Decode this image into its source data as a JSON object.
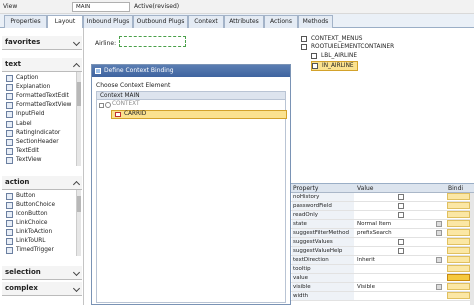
{
  "topbar": {
    "view_label": "View",
    "view_value": "MAIN",
    "status": "Active(revised)"
  },
  "tabs": [
    "Properties",
    "Layout",
    "Inbound Plugs",
    "Outbound Plugs",
    "Context",
    "Attributes",
    "Actions",
    "Methods"
  ],
  "active_tab": "Layout",
  "palette": {
    "sections": [
      {
        "title": "favorites"
      },
      {
        "title": "text",
        "items": [
          "Caption",
          "Explanation",
          "FormattedTextEdit",
          "FormattedTextView",
          "InputField",
          "Label",
          "RatingIndicator",
          "SectionHeader",
          "TextEdit",
          "TextView"
        ]
      },
      {
        "title": "action",
        "items": [
          "Button",
          "ButtonChoice",
          "IconButton",
          "LinkChoice",
          "LinkToAction",
          "LinkToURL",
          "TimedTrigger"
        ]
      },
      {
        "title": "selection"
      },
      {
        "title": "complex"
      }
    ]
  },
  "canvas": {
    "airline_label": "Airline:"
  },
  "dialog": {
    "title": "Define Context Binding",
    "subtitle": "Choose Context Element",
    "header": "Context MAIN",
    "node_root": "CONTEXT",
    "node_child": "CARRID"
  },
  "element_tree": [
    {
      "label": "CONTEXT_MENUS"
    },
    {
      "label": "ROOTUIELEMENTCONTAINER"
    },
    {
      "label": "LBL_AIRLINE"
    },
    {
      "label": "IN_AIRLINE"
    }
  ],
  "properties": {
    "headers": [
      "Property",
      "Value",
      "Bindi"
    ],
    "rows": [
      {
        "name": "noHistory",
        "value": "",
        "kind": "checkbox"
      },
      {
        "name": "passwordField",
        "value": "",
        "kind": "checkbox"
      },
      {
        "name": "readOnly",
        "value": "",
        "kind": "checkbox"
      },
      {
        "name": "state",
        "value": "Normal Item",
        "kind": "dropdown"
      },
      {
        "name": "suggestFilterMethod",
        "value": "prefixSearch",
        "kind": "dropdown"
      },
      {
        "name": "suggestValues",
        "value": "",
        "kind": "checkbox"
      },
      {
        "name": "suggestValueHelp",
        "value": "",
        "kind": "checkbox"
      },
      {
        "name": "textDirection",
        "value": "Inherit",
        "kind": "dropdown"
      },
      {
        "name": "tooltip",
        "value": "",
        "kind": "text"
      },
      {
        "name": "value",
        "value": "",
        "kind": "text"
      },
      {
        "name": "visible",
        "value": "Visible",
        "kind": "dropdown"
      },
      {
        "name": "width",
        "value": "",
        "kind": "text"
      }
    ]
  },
  "colors": {
    "selection": "#fbe28f",
    "title_bar": "#4a6fa8",
    "tab_bg": "#e4ebf4"
  }
}
